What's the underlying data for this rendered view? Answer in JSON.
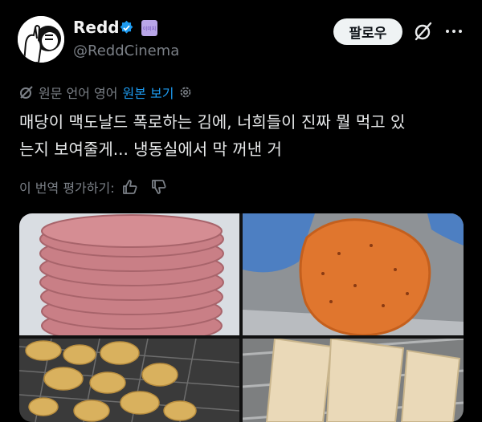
{
  "user": {
    "display_name": "Redd",
    "handle": "@ReddCinema",
    "badge_text": "이미지"
  },
  "header": {
    "follow_label": "팔로우"
  },
  "translation": {
    "source_info": "원문 언어 영어",
    "show_original": "원본 보기"
  },
  "post": {
    "line1": "매당이 맥도날드 폭로하는 김에, 너희들이 진짜 뭘 먹고 있",
    "line2": "는지 보여줄게... 냉동실에서 막 꺼낸 거"
  },
  "rating": {
    "label": "이 번역 평가하기:"
  },
  "colors": {
    "accent": "#1d9bf0",
    "muted": "#7b8087",
    "text": "#e7e9ea",
    "background": "#000000"
  },
  "icons": [
    "verified-badge-icon",
    "grok-icon",
    "more-icon",
    "translate-icon",
    "settings-icon",
    "thumbs-up-icon",
    "thumbs-down-icon"
  ]
}
